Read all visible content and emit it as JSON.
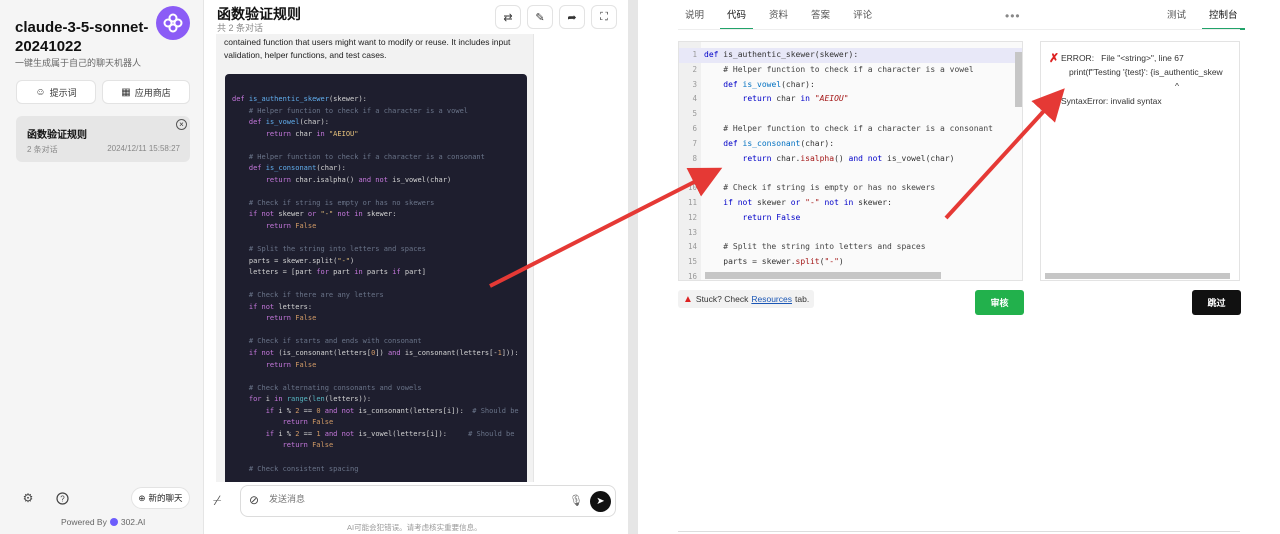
{
  "sidebar": {
    "app_title": "claude-3-5-sonnet-20241022",
    "app_subtitle": "一键生成属于自己的聊天机器人",
    "prompt_btn": "提示词",
    "store_btn": "应用商店",
    "conversation": {
      "title": "函数验证规则",
      "count": "2 条对话",
      "date": "2024/12/11 15:58:27"
    },
    "new_chat": "新的聊天",
    "powered_by": "Powered By",
    "brand": "302.AI"
  },
  "chat": {
    "title": "函数验证规则",
    "subtitle": "共 2 条对话",
    "message_text": "contained function that users might want to modify or reuse. It includes input validation, helper functions, and test cases.",
    "input_placeholder": "发送消息",
    "disclaimer": "AI可能会犯错误。请考虑核实重要信息。"
  },
  "editor": {
    "tabs": [
      "说明",
      "代码",
      "资料",
      "答案",
      "评论"
    ],
    "active_tab": "代码",
    "right_tabs": [
      "测试",
      "控制台"
    ],
    "active_right_tab": "控制台",
    "line_numbers": [
      "1",
      "2",
      "3",
      "4",
      "5",
      "6",
      "7",
      "8",
      "9",
      "10",
      "11",
      "12",
      "13",
      "14",
      "15",
      "16"
    ],
    "console": {
      "error_line1": "ERROR:   File \"<string>\", line 67",
      "error_line2": "print(f\"Testing '{test}': {is_authentic_skew",
      "caret": "^",
      "error_line3": "SyntaxError: invalid syntax"
    },
    "stuck_text": "Stuck? Check",
    "stuck_link": "Resources",
    "stuck_suffix": "tab.",
    "review_btn": "审核",
    "skip_btn": "跳过"
  },
  "colors": {
    "accent_green": "#22b14c",
    "logo_purple": "#8b5cf6",
    "error_red": "#dd2222",
    "arrow_red": "#e53935"
  }
}
